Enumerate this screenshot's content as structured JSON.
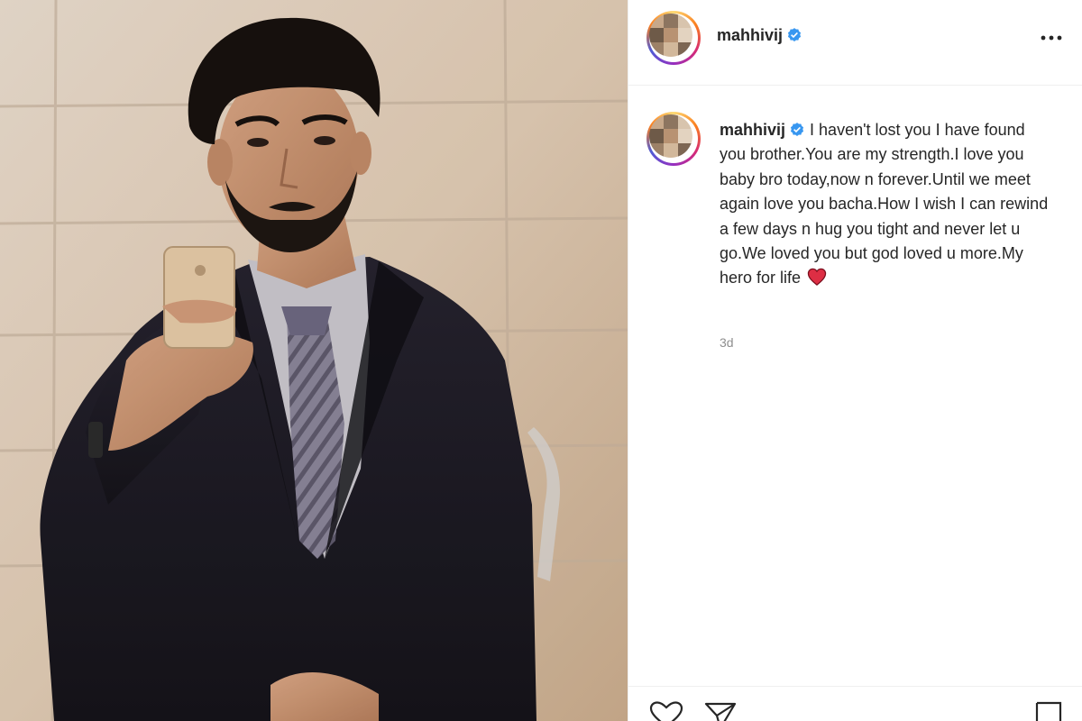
{
  "post": {
    "photo_alt": "Mirror selfie of a young man in a dark suit",
    "author": {
      "username": "mahhivij",
      "verified": true,
      "avatar_icon": "profile-collage-avatar"
    },
    "more_icon": "more-horizontal-icon",
    "caption": {
      "username": "mahhivij",
      "text": "I haven't lost you I have found you brother.You are my strength.I love you baby bro today,now n forever.Until we meet again love you bacha.How I wish I can rewind a few days n hug you tight and never let u go.We loved you but god loved u more.My hero for life",
      "emoji": "red-heart"
    },
    "time_ago": "3d",
    "actions": {
      "like_icon": "heart-outline-icon",
      "share_icon": "paper-plane-icon",
      "save_icon": "bookmark-icon"
    },
    "colors": {
      "verified_blue": "#3897f0",
      "heart_red": "#e0245e",
      "text": "#262626",
      "muted": "#8e8e8e"
    }
  }
}
